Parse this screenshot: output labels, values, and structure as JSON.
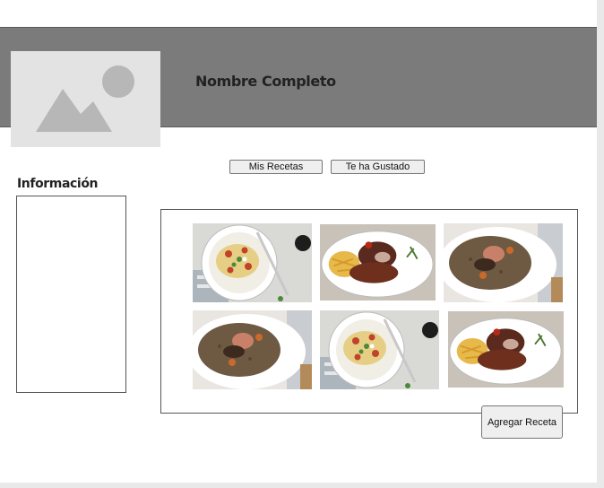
{
  "profile": {
    "full_name": "Nombre Completo",
    "avatar_icon": "image-placeholder-icon"
  },
  "tabs": [
    {
      "label": "Mis Recetas"
    },
    {
      "label": "Te ha Gustado"
    }
  ],
  "info": {
    "label": "Información"
  },
  "gallery": {
    "recipes": [
      {
        "dish": "pasta-plate-photo"
      },
      {
        "dish": "meat-fries-photo"
      },
      {
        "dish": "lentil-stew-photo"
      },
      {
        "dish": "lentil-stew-photo"
      },
      {
        "dish": "pasta-plate-photo"
      },
      {
        "dish": "meat-fries-photo"
      }
    ]
  },
  "actions": {
    "add_recipe": "Agregar Receta"
  },
  "colors": {
    "header": "#7b7b7b",
    "placeholder": "#e3e3e3",
    "button_bg": "#efefef"
  }
}
